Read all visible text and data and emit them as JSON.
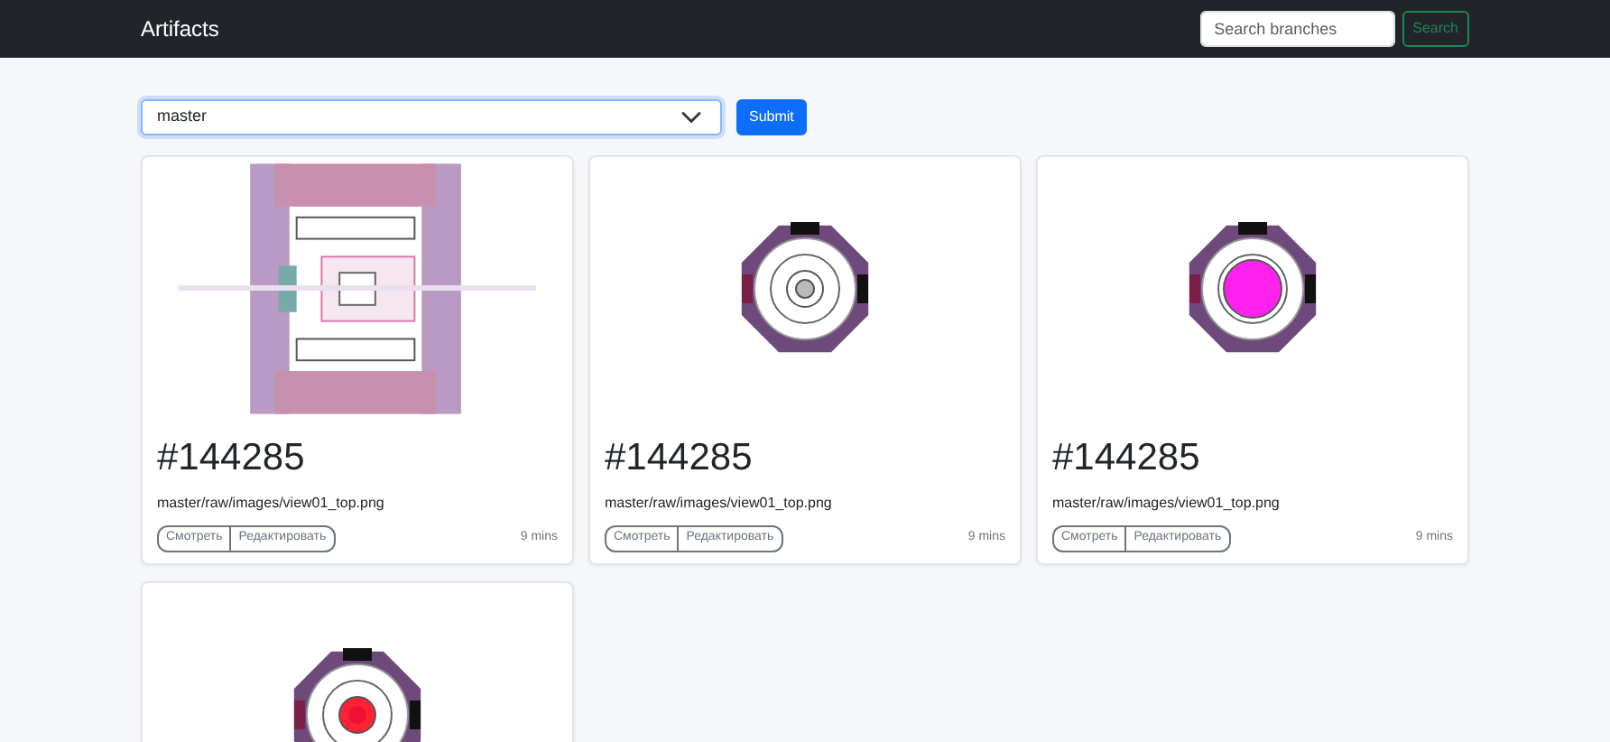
{
  "navbar": {
    "brand": "Artifacts",
    "search": {
      "placeholder": "Search branches",
      "button": "Search"
    }
  },
  "filter": {
    "branch": "master",
    "submit": "Submit"
  },
  "cards": [
    {
      "kind": "picture",
      "title": "#144285",
      "path": "master/raw/images/view01_top.png",
      "buttons": [
        "Смотреть",
        "Редактировать"
      ],
      "time": "9 mins"
    },
    {
      "kind": "picture",
      "title": "#144285",
      "path": "master/raw/images/view01_top.png",
      "buttons": [
        "Смотреть",
        "Редактировать"
      ],
      "time": "9 mins"
    },
    {
      "kind": "picture",
      "title": "#144285",
      "path": "master/raw/images/view01_top.png",
      "buttons": [
        "Смотреть",
        "Редактировать"
      ],
      "time": "9 mins"
    },
    {
      "kind": "picture"
    }
  ]
}
